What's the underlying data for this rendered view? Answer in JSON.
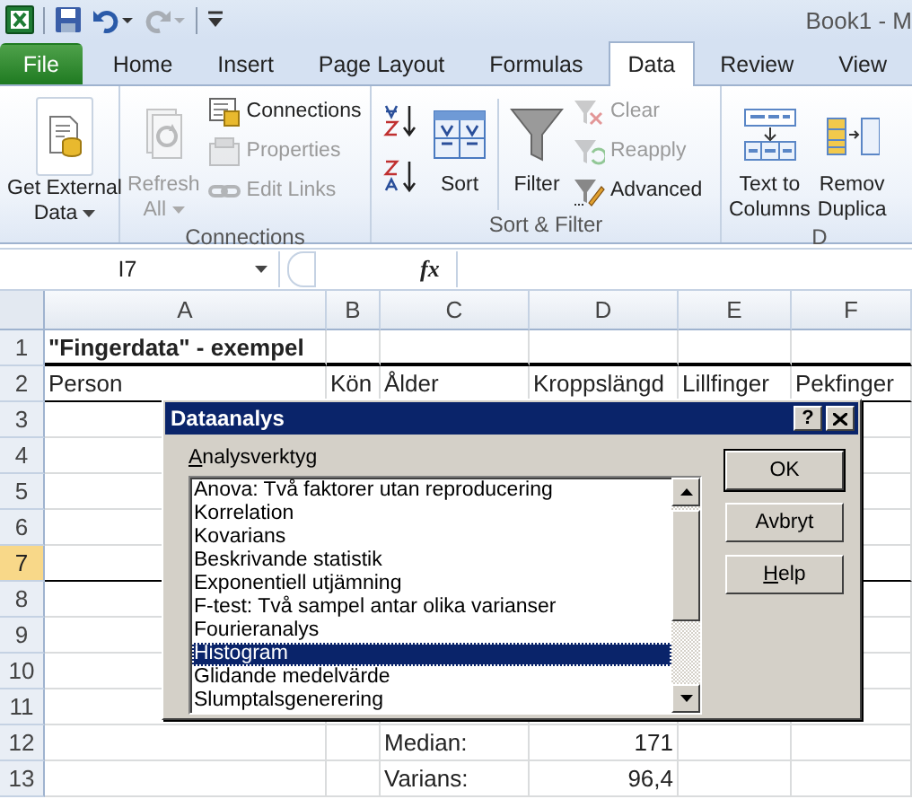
{
  "title_bar": {
    "title": "Book1 - M"
  },
  "tabs": [
    {
      "label": "File",
      "kind": "file",
      "selected": false
    },
    {
      "label": "Home",
      "kind": "tab",
      "selected": false
    },
    {
      "label": "Insert",
      "kind": "tab",
      "selected": false
    },
    {
      "label": "Page Layout",
      "kind": "tab",
      "selected": false
    },
    {
      "label": "Formulas",
      "kind": "tab",
      "selected": false
    },
    {
      "label": "Data",
      "kind": "tab",
      "selected": true
    },
    {
      "label": "Review",
      "kind": "tab",
      "selected": false
    },
    {
      "label": "View",
      "kind": "tab",
      "selected": false
    }
  ],
  "ribbon": {
    "groups": [
      {
        "items": [
          {
            "kind": "large",
            "lines": [
              "Get External",
              "Data"
            ],
            "dropdown": true,
            "disabled": false
          }
        ]
      },
      {
        "label": "Connections",
        "items": [
          {
            "kind": "large",
            "lines": [
              "Refresh",
              "All"
            ],
            "dropdown": true,
            "disabled": true
          },
          {
            "kind": "stack",
            "items": [
              {
                "kind": "small",
                "label": "Connections",
                "disabled": false
              },
              {
                "kind": "small",
                "label": "Properties",
                "disabled": true
              },
              {
                "kind": "small",
                "label": "Edit Links",
                "disabled": true
              }
            ]
          }
        ]
      },
      {
        "label": "Sort & Filter",
        "items": [
          {
            "kind": "stack",
            "items": [
              {
                "kind": "icon",
                "disabled": false
              },
              {
                "kind": "icon",
                "disabled": false
              }
            ]
          },
          {
            "kind": "large",
            "lines": [
              "Sort"
            ],
            "dropdown": false,
            "disabled": false
          },
          {
            "kind": "separator"
          },
          {
            "kind": "large",
            "lines": [
              "Filter"
            ],
            "dropdown": false,
            "disabled": false
          },
          {
            "kind": "stack",
            "items": [
              {
                "kind": "small",
                "label": "Clear",
                "disabled": true
              },
              {
                "kind": "small",
                "label": "Reapply",
                "disabled": true
              },
              {
                "kind": "small",
                "label": "Advanced",
                "disabled": false
              }
            ]
          }
        ]
      },
      {
        "label": "D",
        "items": [
          {
            "kind": "large",
            "lines": [
              "Text to",
              "Columns"
            ],
            "dropdown": false,
            "disabled": false
          },
          {
            "kind": "large",
            "lines": [
              "Remov",
              "Duplica"
            ],
            "dropdown": false,
            "disabled": false
          }
        ]
      }
    ]
  },
  "formula_bar": {
    "name_box": "I7",
    "fx": "fx"
  },
  "sheet": {
    "columns": [
      "A",
      "B",
      "C",
      "D",
      "E",
      "F"
    ],
    "rows": [
      {
        "number": "1",
        "selected": false,
        "bold": true,
        "thick_rule_below": true,
        "cells": [
          "\"Fingerdata\" - exempel"
        ]
      },
      {
        "number": "2",
        "selected": false,
        "rule_below": true,
        "cells": [
          "Person",
          "Kön",
          "Ålder",
          "Kroppslängd",
          "Lillfinger",
          "Pekfinger"
        ]
      },
      {
        "number": "3",
        "selected": false,
        "cells": []
      },
      {
        "number": "4",
        "selected": false,
        "cells": []
      },
      {
        "number": "5",
        "selected": false,
        "cells": []
      },
      {
        "number": "6",
        "selected": false,
        "cells": []
      },
      {
        "number": "7",
        "selected": true,
        "rule_below": true,
        "cells": []
      },
      {
        "number": "8",
        "selected": false,
        "cells": []
      },
      {
        "number": "9",
        "selected": false,
        "cells": []
      },
      {
        "number": "10",
        "selected": false,
        "cells": []
      },
      {
        "number": "11",
        "selected": false,
        "cells": []
      },
      {
        "number": "12",
        "selected": false,
        "cells": [
          "",
          "",
          "Median:",
          "171"
        ]
      },
      {
        "number": "13",
        "selected": false,
        "cells": [
          "",
          "",
          "Varians:",
          "96,4"
        ]
      }
    ]
  },
  "dialog": {
    "title": "Dataanalys",
    "help": "?",
    "list_label": "Analysverktyg",
    "items": [
      {
        "label": "Anova: Två faktorer utan reproducering",
        "selected": false
      },
      {
        "label": "Korrelation",
        "selected": false
      },
      {
        "label": "Kovarians",
        "selected": false
      },
      {
        "label": "Beskrivande statistik",
        "selected": false
      },
      {
        "label": "Exponentiell utjämning",
        "selected": false
      },
      {
        "label": "F-test: Två sampel antar olika varianser",
        "selected": false
      },
      {
        "label": "Fourieranalys",
        "selected": false
      },
      {
        "label": "Histogram",
        "selected": true
      },
      {
        "label": "Glidande medelvärde",
        "selected": false
      },
      {
        "label": "Slumptalsgenerering",
        "selected": false
      }
    ],
    "buttons": [
      {
        "label": "OK",
        "kind": "default"
      },
      {
        "label": "Avbryt",
        "kind": "normal"
      },
      {
        "label": "Help",
        "kind": "mnemonic"
      }
    ]
  }
}
